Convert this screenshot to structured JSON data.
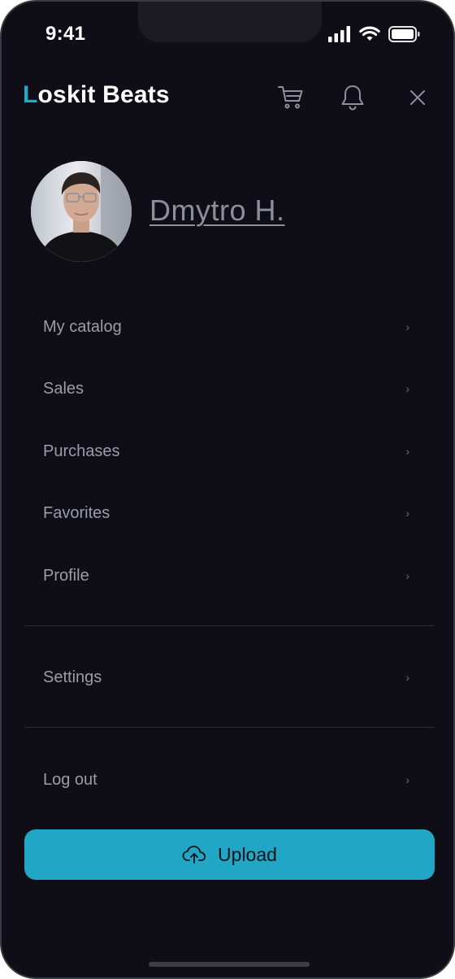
{
  "status_bar": {
    "time": "9:41"
  },
  "header": {
    "logo_first": "L",
    "logo_rest": "oskit Beats",
    "icons": [
      "cart-icon",
      "bell-icon",
      "close-icon"
    ]
  },
  "profile": {
    "name": "Dmytro H."
  },
  "menu": {
    "items": [
      {
        "label": "My catalog"
      },
      {
        "label": "Sales"
      },
      {
        "label": "Purchases"
      },
      {
        "label": "Favorites"
      },
      {
        "label": "Profile"
      }
    ],
    "settings": {
      "label": "Settings"
    },
    "logout": {
      "label": "Log out"
    },
    "chevron": "›"
  },
  "upload": {
    "label": "Upload",
    "icon": "cloud-upload-icon"
  },
  "colors": {
    "background": "#0f0e16",
    "accent": "#22a6c5",
    "text_muted": "#9a9ca6"
  }
}
